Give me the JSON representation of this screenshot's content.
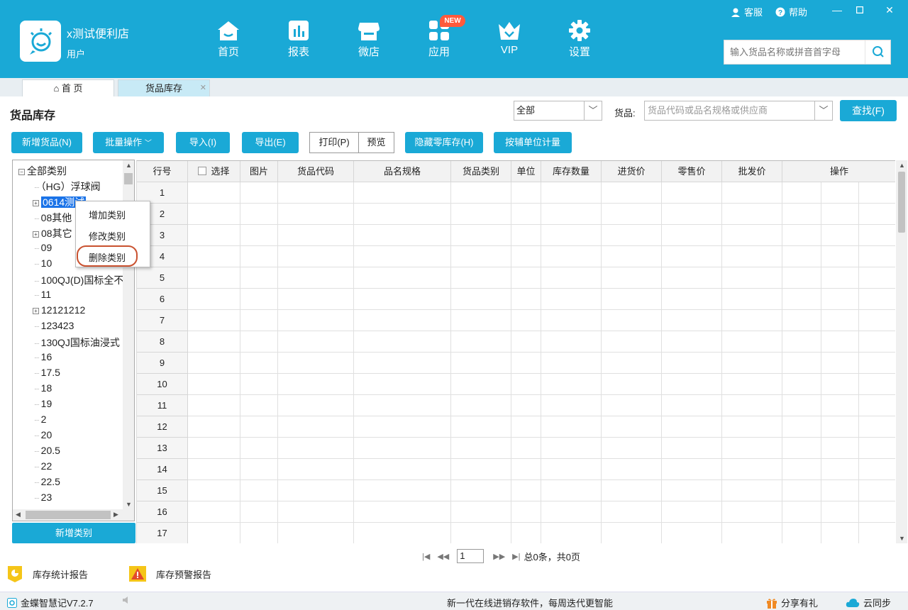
{
  "header": {
    "store_name": "x测试便利店",
    "user_role": "用户",
    "nav": [
      {
        "label": "首页",
        "icon": "home-icon"
      },
      {
        "label": "报表",
        "icon": "report-icon"
      },
      {
        "label": "微店",
        "icon": "shop-icon"
      },
      {
        "label": "应用",
        "icon": "apps-icon"
      },
      {
        "label": "VIP",
        "icon": "vip-crown-icon"
      },
      {
        "label": "设置",
        "icon": "gear-icon"
      }
    ],
    "new_badge": "NEW",
    "service_label": "客服",
    "help_label": "帮助",
    "search_placeholder": "输入货品名称或拼音首字母"
  },
  "tabs": [
    {
      "label": "首 页",
      "active": false
    },
    {
      "label": "货品库存",
      "active": true
    }
  ],
  "page": {
    "title": "货品库存",
    "category_filter": "全部",
    "goods_label": "货品:",
    "goods_placeholder": "货品代码或品名规格或供应商",
    "find_button": "查找(F)"
  },
  "toolbar": {
    "add_goods": "新增货品(N)",
    "batch_ops": "批量操作",
    "import": "导入(I)",
    "export": "导出(E)",
    "print": "打印(P)",
    "preview": "预览",
    "hide_zero_stock": "隐藏零库存(H)",
    "aux_unit": "按辅单位计量"
  },
  "tree": {
    "root": "全部类别",
    "items": [
      "（HG）浮球阀",
      "0614测试",
      "08其他",
      "08其它",
      "09",
      "10",
      "100QJ(D)国标全不",
      "11",
      "12121212",
      "123423",
      "130QJ国标油浸式",
      "16",
      "17.5",
      "18",
      "19",
      "2",
      "20",
      "20.5",
      "22",
      "22.5",
      "23"
    ],
    "expandable": [
      1,
      3,
      8
    ],
    "selected_index": 1,
    "add_category_button": "新增类别"
  },
  "context_menu": {
    "items": [
      "增加类别",
      "修改类别",
      "删除类别"
    ],
    "highlighted_index": 2
  },
  "table": {
    "columns": [
      "行号",
      "选择",
      "图片",
      "货品代码",
      "品名规格",
      "货品类别",
      "单位",
      "库存数量",
      "进货价",
      "零售价",
      "批发价",
      "操作"
    ],
    "row_numbers": [
      "1",
      "2",
      "3",
      "4",
      "5",
      "6",
      "7",
      "8",
      "9",
      "10",
      "11",
      "12",
      "13",
      "14",
      "15",
      "16",
      "17"
    ]
  },
  "pager": {
    "page_value": "1",
    "summary": "总0条，共0页"
  },
  "reports": {
    "stock_stats": "库存统计报告",
    "stock_warning": "库存预警报告"
  },
  "status_bar": {
    "version": "金蝶智慧记V7.2.7",
    "slogan": "新一代在线进销存软件，每周迭代更智能",
    "share": "分享有礼",
    "sync": "云同步"
  },
  "colors": {
    "brand": "#1aa9d6",
    "selection": "#1a73e8",
    "highlight_ring": "#c9512f",
    "new_badge": "#ff5a3c"
  }
}
